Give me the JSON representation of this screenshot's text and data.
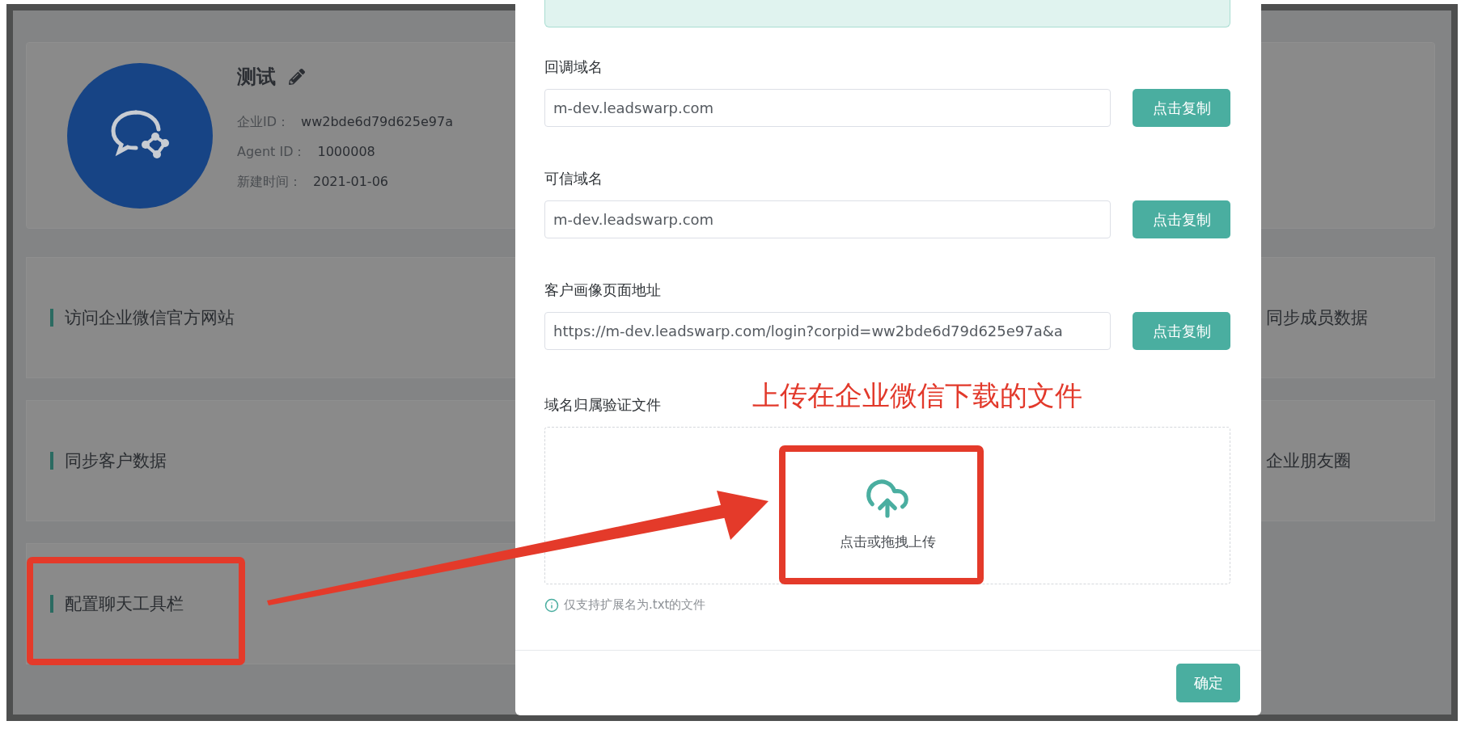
{
  "profile": {
    "name": "测试",
    "fields": [
      {
        "label": "企业ID：",
        "value": "ww2bde6d79d625e97a"
      },
      {
        "label": "Agent ID：",
        "value": "1000008"
      },
      {
        "label": "新建时间：",
        "value": "2021-01-06"
      }
    ]
  },
  "left_cards": [
    {
      "label": "访问企业微信官方网站"
    },
    {
      "label": "同步客户数据"
    },
    {
      "label": "配置聊天工具栏"
    }
  ],
  "right_cards": [
    {
      "label": "同步成员数据"
    },
    {
      "label": "企业朋友圈"
    }
  ],
  "modal": {
    "fields": [
      {
        "label": "回调域名",
        "value": "m-dev.leadswarp.com",
        "button": "点击复制"
      },
      {
        "label": "可信域名",
        "value": "m-dev.leadswarp.com",
        "button": "点击复制"
      },
      {
        "label": "客户画像页面地址",
        "value": "https://m-dev.leadswarp.com/login?corpid=ww2bde6d79d625e97a&a",
        "button": "点击复制"
      }
    ],
    "upload": {
      "label": "域名归属验证文件",
      "prompt": "点击或拖拽上传",
      "hint": "仅支持扩展名为.txt的文件"
    },
    "confirm": "确定"
  },
  "annotation": {
    "text": "上传在企业微信下载的文件"
  }
}
